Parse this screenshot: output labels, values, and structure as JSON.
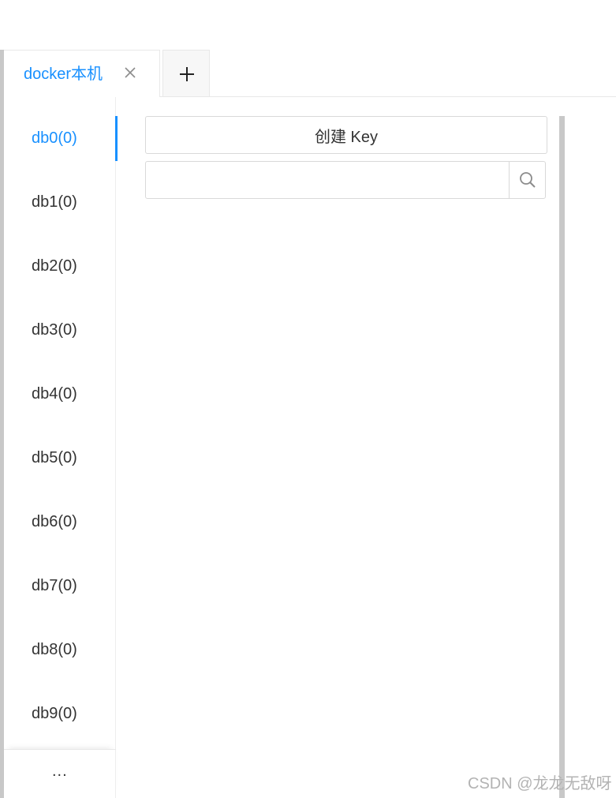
{
  "tabs": {
    "active_label": "docker本机",
    "close_symbol": "×",
    "add_symbol": "+"
  },
  "databases": [
    {
      "label": "db0(0)",
      "active": true
    },
    {
      "label": "db1(0)",
      "active": false
    },
    {
      "label": "db2(0)",
      "active": false
    },
    {
      "label": "db3(0)",
      "active": false
    },
    {
      "label": "db4(0)",
      "active": false
    },
    {
      "label": "db5(0)",
      "active": false
    },
    {
      "label": "db6(0)",
      "active": false
    },
    {
      "label": "db7(0)",
      "active": false
    },
    {
      "label": "db8(0)",
      "active": false
    },
    {
      "label": "db9(0)",
      "active": false
    }
  ],
  "db_more_label": "...",
  "main": {
    "create_key_label": "创建 Key",
    "search_placeholder": "",
    "search_value": ""
  },
  "icons": {
    "tab_close": "close-icon",
    "tab_add": "plus-icon",
    "search": "search-icon"
  },
  "colors": {
    "accent": "#1890ff",
    "text": "#333333",
    "border": "#d9d9d9",
    "scrollbar": "#c8c8c8"
  },
  "watermark": "CSDN @龙龙无敌呀"
}
